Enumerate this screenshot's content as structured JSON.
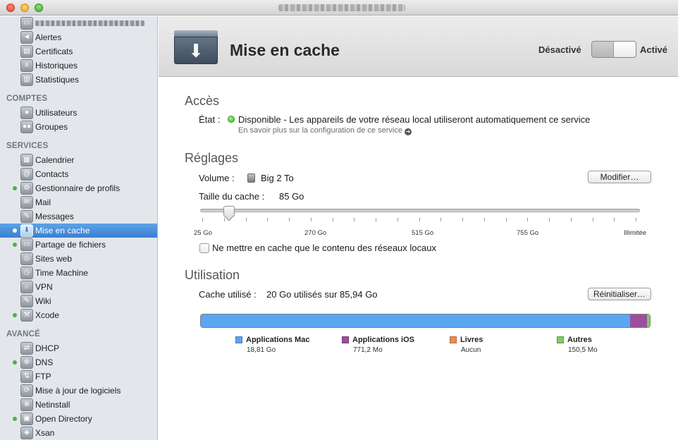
{
  "colors": {
    "accent_selected": "#3a7fd3",
    "status_green": "#47b53a",
    "mac": "#5aa6f0",
    "ios": "#9c4f9e",
    "books": "#f08a4b",
    "others": "#7ccf5a"
  },
  "sidebar": {
    "sections": {
      "comptes": "COMPTES",
      "services": "SERVICES",
      "avance": "AVANCÉ"
    },
    "top_items": [
      {
        "label": "Alertes",
        "icon": "megaphone-icon"
      },
      {
        "label": "Certificats",
        "icon": "certificate-icon"
      },
      {
        "label": "Historiques",
        "icon": "logs-icon"
      },
      {
        "label": "Statistiques",
        "icon": "stats-icon"
      }
    ],
    "comptes_items": [
      {
        "label": "Utilisateurs",
        "icon": "user-icon"
      },
      {
        "label": "Groupes",
        "icon": "group-icon"
      }
    ],
    "services_items": [
      {
        "label": "Calendrier",
        "icon": "calendar-icon",
        "active": false
      },
      {
        "label": "Contacts",
        "icon": "contacts-icon",
        "active": false
      },
      {
        "label": "Gestionnaire de profils",
        "icon": "profile-manager-icon",
        "active": true
      },
      {
        "label": "Mail",
        "icon": "mail-icon",
        "active": false
      },
      {
        "label": "Messages",
        "icon": "messages-icon",
        "active": false
      },
      {
        "label": "Mise en cache",
        "icon": "caching-icon",
        "active": true,
        "selected": true
      },
      {
        "label": "Partage de fichiers",
        "icon": "file-sharing-icon",
        "active": true
      },
      {
        "label": "Sites web",
        "icon": "websites-icon",
        "active": false
      },
      {
        "label": "Time Machine",
        "icon": "time-machine-icon",
        "active": false
      },
      {
        "label": "VPN",
        "icon": "vpn-icon",
        "active": false
      },
      {
        "label": "Wiki",
        "icon": "wiki-icon",
        "active": false
      },
      {
        "label": "Xcode",
        "icon": "xcode-icon",
        "active": true
      }
    ],
    "avance_items": [
      {
        "label": "DHCP",
        "icon": "dhcp-icon",
        "active": false
      },
      {
        "label": "DNS",
        "icon": "dns-icon",
        "active": true
      },
      {
        "label": "FTP",
        "icon": "ftp-icon",
        "active": false
      },
      {
        "label": "Mise à jour de logiciels",
        "icon": "software-update-icon",
        "active": false
      },
      {
        "label": "Netinstall",
        "icon": "netinstall-icon",
        "active": false
      },
      {
        "label": "Open Directory",
        "icon": "open-directory-icon",
        "active": true
      },
      {
        "label": "Xsan",
        "icon": "xsan-icon",
        "active": false
      }
    ]
  },
  "header": {
    "title": "Mise en cache",
    "toggle_off_label": "Désactivé",
    "toggle_on_label": "Activé",
    "toggle_state": "on"
  },
  "acces": {
    "heading": "Accès",
    "state_label": "État :",
    "state_value": "Disponible - Les appareils de votre réseau local utiliseront automatiquement ce service",
    "learn_more": "En savoir plus sur la configuration de ce service"
  },
  "reglages": {
    "heading": "Réglages",
    "volume_label": "Volume :",
    "volume_value": "Big 2 To",
    "modify_button": "Modifier…",
    "cache_size_label": "Taille du cache :",
    "cache_size_value": "85 Go",
    "slider_ticks": [
      "25 Go",
      "270 Go",
      "515 Go",
      "755 Go",
      "Illimitée"
    ],
    "slider_value_gb": 85,
    "local_only_label": "Ne mettre en cache que le contenu des réseaux locaux",
    "local_only_checked": false
  },
  "utilisation": {
    "heading": "Utilisation",
    "used_label": "Cache utilisé :",
    "used_value": "20 Go utilisés sur 85,94 Go",
    "reset_button": "Réinitialiser…",
    "segments": [
      {
        "name": "Applications Mac",
        "value": "18,81 Go",
        "fraction": 0.96,
        "color_key": "mac"
      },
      {
        "name": "Applications iOS",
        "value": "771,2 Mo",
        "fraction": 0.037,
        "color_key": "ios"
      },
      {
        "name": "Livres",
        "value": "Aucun",
        "fraction": 0,
        "color_key": "books"
      },
      {
        "name": "Autres",
        "value": "150,5 Mo",
        "fraction": 0.007,
        "color_key": "others"
      }
    ]
  }
}
